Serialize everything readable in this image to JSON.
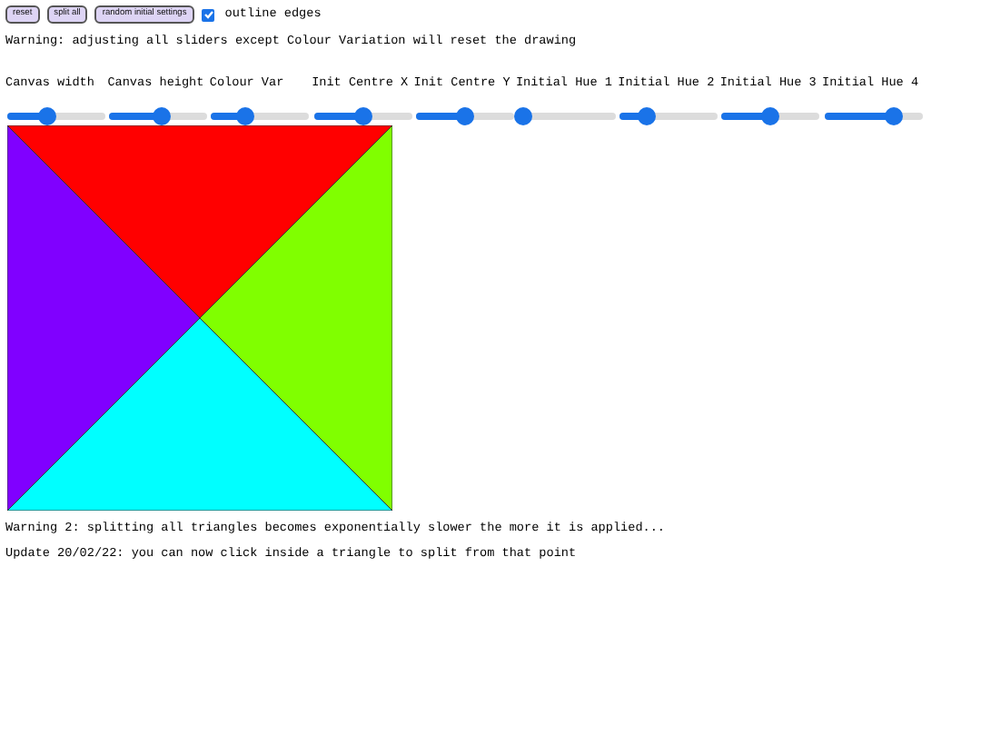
{
  "buttons": [
    {
      "label": "reset"
    },
    {
      "label": "split all"
    },
    {
      "label": "random initial settings"
    }
  ],
  "outline_edges": {
    "label": "outline edges",
    "checked": true
  },
  "warning": "Warning: adjusting all sliders except Colour Variation will reset the drawing",
  "sliders": [
    {
      "label": "Canvas width",
      "level": 0.4
    },
    {
      "label": "Canvas height",
      "level": 0.53
    },
    {
      "label": "Colour Var",
      "level": 0.35
    },
    {
      "label": "Init Centre X",
      "level": 0.5
    },
    {
      "label": "Init Centre Y",
      "level": 0.5
    },
    {
      "label": "Initial Hue 1",
      "level": 0.05
    },
    {
      "label": "Initial Hue 2",
      "level": 0.28
    },
    {
      "label": "Initial Hue 3",
      "level": 0.5
    },
    {
      "label": "Initial Hue 4",
      "level": 0.72
    }
  ],
  "triangles": [
    {
      "color": "#ff0000"
    },
    {
      "color": "#80ff00"
    },
    {
      "color": "#00ffff"
    },
    {
      "color": "#8000ff"
    }
  ],
  "warning_2": "Warning 2: splitting all triangles becomes exponentially slower the more it is applied...",
  "update": "Update 20/02/22: you can now click inside a triangle to split from that point"
}
